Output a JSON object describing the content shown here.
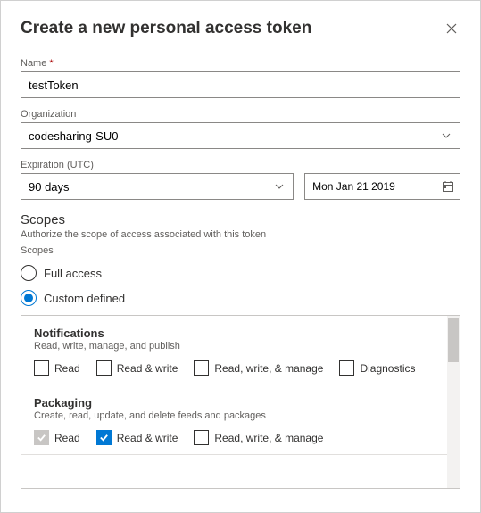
{
  "title": "Create a new personal access token",
  "fields": {
    "name": {
      "label": "Name",
      "required": "*",
      "value": "testToken"
    },
    "organization": {
      "label": "Organization",
      "value": "codesharing-SU0"
    },
    "expiration": {
      "label": "Expiration (UTC)",
      "duration": "90 days",
      "date": "Mon Jan 21 2019"
    }
  },
  "scopes": {
    "title": "Scopes",
    "subtitle": "Authorize the scope of access associated with this token",
    "group_label": "Scopes",
    "options": {
      "full": "Full access",
      "custom": "Custom defined"
    },
    "sections": [
      {
        "name": "Notifications",
        "desc": "Read, write, manage, and publish",
        "checks": [
          {
            "label": "Read",
            "checked": false,
            "disabled": false
          },
          {
            "label": "Read & write",
            "checked": false,
            "disabled": false
          },
          {
            "label": "Read, write, & manage",
            "checked": false,
            "disabled": false
          },
          {
            "label": "Diagnostics",
            "checked": false,
            "disabled": false
          }
        ]
      },
      {
        "name": "Packaging",
        "desc": "Create, read, update, and delete feeds and packages",
        "checks": [
          {
            "label": "Read",
            "checked": true,
            "disabled": true
          },
          {
            "label": "Read & write",
            "checked": true,
            "disabled": false
          },
          {
            "label": "Read, write, & manage",
            "checked": false,
            "disabled": false
          }
        ]
      }
    ]
  }
}
